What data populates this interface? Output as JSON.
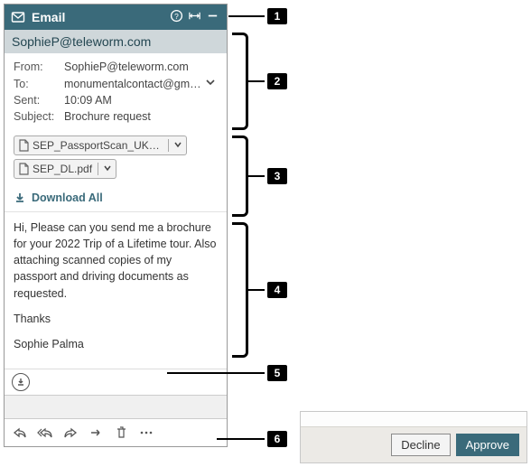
{
  "titlebar": {
    "title": "Email"
  },
  "sender_header": "SophieP@teleworm.com",
  "meta": {
    "from_label": "From:",
    "from_value": "SophieP@teleworm.com",
    "to_label": "To:",
    "to_value": "monumentalcontact@gmail.c...",
    "sent_label": "Sent:",
    "sent_value": "10:09 AM",
    "subject_label": "Subject:",
    "subject_value": "Brochure request"
  },
  "attachments": [
    {
      "name": "SEP_PassportScan_UK_.pdf"
    },
    {
      "name": "SEP_DL.pdf"
    }
  ],
  "download_all_label": "Download All",
  "body": {
    "para1": "Hi, Please can you send me a brochure for your 2022 Trip of a Lifetime tour. Also attaching scanned copies of my passport and driving documents as requested.",
    "para2": "Thanks",
    "para3": "Sophie Palma"
  },
  "callouts": {
    "n1": "1",
    "n2": "2",
    "n3": "3",
    "n4": "4",
    "n5": "5",
    "n6": "6"
  },
  "approval": {
    "decline": "Decline",
    "approve": "Approve"
  }
}
